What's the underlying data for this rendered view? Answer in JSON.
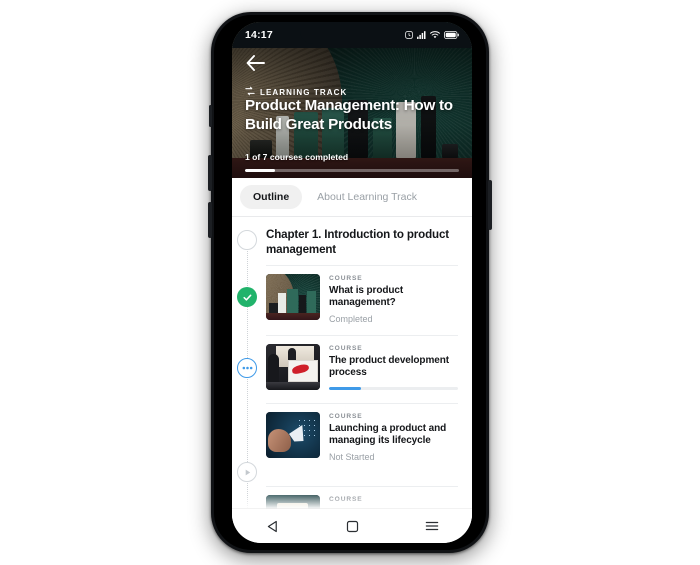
{
  "status_bar": {
    "time": "14:17",
    "icons": [
      "bluetooth-icon",
      "alarm-icon",
      "cellular-signal-icon",
      "wifi-icon",
      "battery-icon"
    ]
  },
  "hero": {
    "back_icon": "back-arrow-icon",
    "kicker_icon": "learning-track-icon",
    "kicker": "LEARNING TRACK",
    "title": "Product Management: How to Build Great Products",
    "progress_label": "1 of 7 courses completed",
    "progress_percent": 14,
    "courses_completed": 1,
    "courses_total": 7
  },
  "tabs": [
    {
      "label": "Outline",
      "active": true
    },
    {
      "label": "About Learning Track",
      "active": false
    }
  ],
  "outline": {
    "chapter_title": "Chapter 1. Introduction to product management",
    "courses": [
      {
        "kicker": "COURSE",
        "name": "What is product management?",
        "status": "Completed",
        "node": "check-icon",
        "progress_percent": null,
        "thumbnail": "green-product-bottles-thumbnail"
      },
      {
        "kicker": "COURSE",
        "name": "The product development process",
        "status": null,
        "node": "in-progress-dots-icon",
        "progress_percent": 25,
        "thumbnail": "photo-studio-monitor-thumbnail"
      },
      {
        "kicker": "COURSE",
        "name": "Launching a product and managing its lifecycle",
        "status": "Not Started",
        "node": "play-icon",
        "progress_percent": null,
        "thumbnail": "hand-digital-rocket-thumbnail"
      },
      {
        "kicker": "COURSE",
        "name": "",
        "status": null,
        "node": "",
        "progress_percent": null,
        "thumbnail": "partial-course-thumbnail"
      }
    ]
  },
  "android_nav": {
    "back": "nav-back-icon",
    "home": "nav-home-icon",
    "recents": "nav-recents-icon"
  },
  "colors": {
    "accent_blue": "#3f9ae8",
    "success_green": "#21b36b",
    "hero_dark": "#0d2b26",
    "muted_text": "#9aa0a6"
  }
}
